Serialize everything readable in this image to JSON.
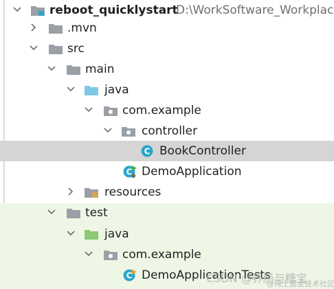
{
  "tree": {
    "project": {
      "name": "reboot_quicklystart",
      "path": "D:\\WorkSoftware_Workplac"
    },
    "mvn": ".mvn",
    "src": "src",
    "main": "main",
    "main_java": "java",
    "main_pkg": "com.example",
    "controller": "controller",
    "book_controller": "BookController",
    "demo_app": "DemoApplication",
    "resources": "resources",
    "test": "test",
    "test_java": "java",
    "test_pkg": "com.example",
    "demo_tests": "DemoApplicationTests"
  },
  "watermark": {
    "line1": "CSDN @养肠与糖宝",
    "line2": "@稀土掘金技术社区"
  },
  "colors": {
    "selection": "#d5d5d5",
    "test_area": "#eef7e6",
    "folder": "#9aa0a6",
    "source_root": "#7fc8e6",
    "test_root": "#8cc775",
    "class": "#2aa6c8"
  },
  "icons": {
    "folder": "folder-icon",
    "source_root": "source-root-folder-icon",
    "test_root": "test-root-folder-icon",
    "package": "package-icon",
    "class": "class-icon",
    "runnable_class": "runnable-class-icon",
    "resources": "resources-folder-icon",
    "module": "module-icon"
  }
}
